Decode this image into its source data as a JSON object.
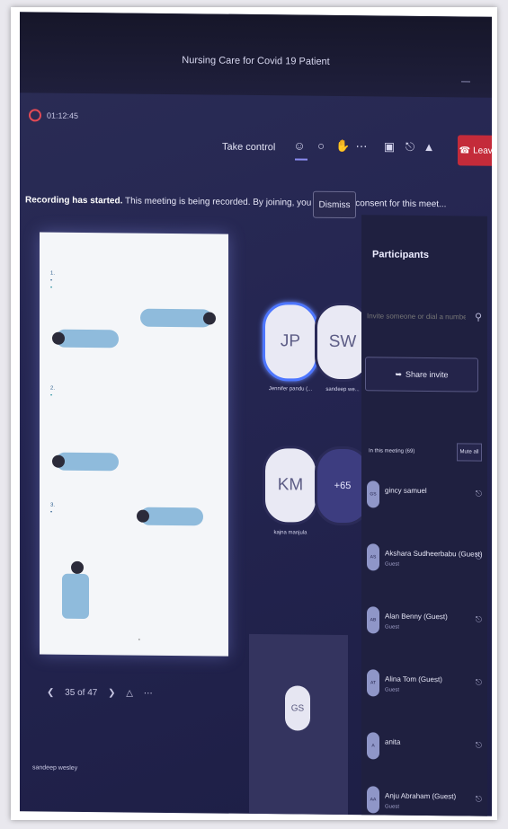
{
  "window": {
    "title": "Nursing Care for Covid 19 Patient",
    "timer": "01:12:45"
  },
  "toolbar": {
    "take_control_label": "Take control",
    "icons": [
      "people-icon",
      "chat-icon",
      "raise-hand-icon",
      "more-icon",
      "camera-off-icon",
      "mic-off-icon",
      "share-tray-icon",
      "phone-icon"
    ],
    "leave_label": "Leave"
  },
  "banner": {
    "bold_text": "Recording has started.",
    "message": " This meeting is being recorded. By joining, you are giving consent for this meet...",
    "dismiss_label": "Dismiss"
  },
  "slide_nav": {
    "counter": "35 of 47"
  },
  "tiles": [
    {
      "initials": "JP",
      "name": "Jennifer pandu (..."
    },
    {
      "initials": "SW",
      "name": "sandeep we..."
    },
    {
      "initials": "KM",
      "name": "kajna manjula"
    },
    {
      "initials": "+65",
      "name": ""
    }
  ],
  "self_tile": {
    "initials": "GS"
  },
  "presenter_name": "sandeep wesley",
  "participants_panel": {
    "title": "Participants",
    "invite_placeholder": "Invite someone or dial a number",
    "share_invite_label": "Share invite",
    "section_label": "In this meeting (69)",
    "mute_all_label": "Mute all",
    "people": [
      {
        "initials": "GS",
        "name": "gincy samuel",
        "guest": ""
      },
      {
        "initials": "AS",
        "name": "Akshara Sudheerbabu (Guest)",
        "guest": "Guest"
      },
      {
        "initials": "AB",
        "name": "Alan Benny (Guest)",
        "guest": "Guest"
      },
      {
        "initials": "AT",
        "name": "Alina Tom (Guest)",
        "guest": "Guest"
      },
      {
        "initials": "A",
        "name": "anita",
        "guest": ""
      },
      {
        "initials": "AA",
        "name": "Anju Abraham (Guest)",
        "guest": "Guest"
      }
    ]
  },
  "colors": {
    "leave": "#c42b3a",
    "accent": "#8b8cf0",
    "background": "#252652"
  }
}
